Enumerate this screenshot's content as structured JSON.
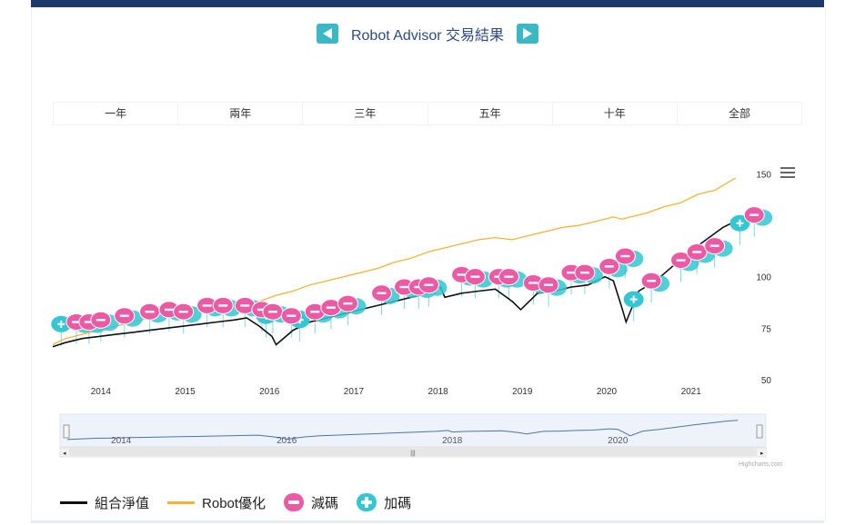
{
  "header": {
    "title": "Robot Advisor 交易結果",
    "prev_icon": "arrow-left-icon",
    "next_icon": "arrow-right-icon",
    "accent": "#3ab8c6",
    "title_color": "#2b4a86"
  },
  "tabs": [
    {
      "label": "一年"
    },
    {
      "label": "兩年"
    },
    {
      "label": "三年"
    },
    {
      "label": "五年"
    },
    {
      "label": "十年"
    },
    {
      "label": "全部"
    }
  ],
  "menu_icon": "hamburger-icon",
  "legend": {
    "portfolio": "組合淨值",
    "robot": "Robot優化",
    "reduce": "減碼",
    "add": "加碼"
  },
  "credits": "Highcharts.com",
  "chart_data": {
    "type": "line",
    "ylim": [
      50,
      155
    ],
    "y_ticks": [
      50,
      75,
      100,
      150
    ],
    "y_tick_labels": [
      "50",
      "75",
      "100",
      "150"
    ],
    "x_ticks": [
      "2014",
      "2015",
      "2016",
      "2017",
      "2018",
      "2019",
      "2020",
      "2021"
    ],
    "navigator_ticks": [
      "2014",
      "2016",
      "2018",
      "2020"
    ],
    "colors": {
      "portfolio": "#111111",
      "robot": "#f5b335",
      "reduce": "#ec5aa5",
      "add": "#34c6d3",
      "navigator": "#4a74b4"
    },
    "series": [
      {
        "name": "組合淨值",
        "x": [
          2013.45,
          2013.6,
          2013.8,
          2014.0,
          2014.2,
          2014.4,
          2014.6,
          2014.8,
          2015.0,
          2015.2,
          2015.4,
          2015.6,
          2015.75,
          2015.9,
          2016.05,
          2016.1,
          2016.3,
          2016.5,
          2016.7,
          2016.9,
          2017.1,
          2017.3,
          2017.5,
          2017.7,
          2017.9,
          2018.05,
          2018.1,
          2018.3,
          2018.5,
          2018.7,
          2018.9,
          2019.0,
          2019.2,
          2019.4,
          2019.6,
          2019.8,
          2020.0,
          2020.1,
          2020.2,
          2020.25,
          2020.4,
          2020.6,
          2020.8,
          2021.0,
          2021.2,
          2021.4,
          2021.55
        ],
        "values": [
          66,
          68,
          70,
          71,
          72,
          73,
          74,
          75,
          76,
          77,
          78,
          79,
          80,
          76,
          71,
          67,
          74,
          78,
          80,
          82,
          84,
          86,
          88,
          90,
          92,
          95,
          90,
          92,
          93,
          94,
          88,
          84,
          92,
          93,
          95,
          96,
          100,
          98,
          85,
          78,
          93,
          98,
          105,
          112,
          118,
          124,
          127
        ]
      },
      {
        "name": "Robot優化",
        "x": [
          2013.45,
          2013.6,
          2013.8,
          2014.0,
          2014.2,
          2014.4,
          2014.6,
          2014.8,
          2015.0,
          2015.2,
          2015.4,
          2015.6,
          2015.75,
          2015.9,
          2016.1,
          2016.3,
          2016.5,
          2016.7,
          2016.9,
          2017.1,
          2017.3,
          2017.5,
          2017.7,
          2017.9,
          2018.1,
          2018.3,
          2018.5,
          2018.7,
          2018.9,
          2019.1,
          2019.3,
          2019.5,
          2019.7,
          2019.9,
          2020.1,
          2020.2,
          2020.3,
          2020.5,
          2020.7,
          2020.9,
          2021.1,
          2021.3,
          2021.55
        ],
        "values": [
          67,
          70,
          72,
          74,
          76,
          78,
          80,
          82,
          84,
          85,
          86,
          86,
          87,
          88,
          91,
          93,
          96,
          98,
          100,
          102,
          104,
          107,
          109,
          112,
          114,
          116,
          118,
          119,
          118,
          120,
          122,
          124,
          125,
          127,
          129,
          128,
          129,
          131,
          134,
          136,
          140,
          142,
          148
        ]
      }
    ],
    "flags_reduce": [
      {
        "x": 2013.73,
        "y": 78
      },
      {
        "x": 2013.88,
        "y": 78
      },
      {
        "x": 2014.02,
        "y": 79
      },
      {
        "x": 2014.3,
        "y": 81
      },
      {
        "x": 2014.6,
        "y": 83
      },
      {
        "x": 2014.83,
        "y": 84
      },
      {
        "x": 2015.0,
        "y": 83
      },
      {
        "x": 2015.28,
        "y": 86
      },
      {
        "x": 2015.47,
        "y": 86
      },
      {
        "x": 2015.73,
        "y": 86
      },
      {
        "x": 2015.93,
        "y": 84
      },
      {
        "x": 2016.06,
        "y": 83
      },
      {
        "x": 2016.28,
        "y": 81
      },
      {
        "x": 2016.56,
        "y": 83
      },
      {
        "x": 2016.75,
        "y": 85
      },
      {
        "x": 2016.95,
        "y": 87
      },
      {
        "x": 2017.35,
        "y": 92
      },
      {
        "x": 2017.62,
        "y": 95
      },
      {
        "x": 2017.79,
        "y": 95
      },
      {
        "x": 2017.91,
        "y": 96
      },
      {
        "x": 2018.3,
        "y": 101
      },
      {
        "x": 2018.46,
        "y": 100
      },
      {
        "x": 2018.74,
        "y": 100
      },
      {
        "x": 2018.86,
        "y": 100
      },
      {
        "x": 2019.15,
        "y": 97
      },
      {
        "x": 2019.33,
        "y": 96
      },
      {
        "x": 2019.6,
        "y": 102
      },
      {
        "x": 2019.76,
        "y": 102
      },
      {
        "x": 2020.05,
        "y": 105
      },
      {
        "x": 2020.24,
        "y": 110
      },
      {
        "x": 2020.55,
        "y": 98
      },
      {
        "x": 2020.9,
        "y": 108
      },
      {
        "x": 2021.09,
        "y": 112
      },
      {
        "x": 2021.3,
        "y": 115
      },
      {
        "x": 2021.77,
        "y": 130
      }
    ],
    "flags_add": [
      {
        "x": 2013.55,
        "y": 77
      },
      {
        "x": 2015.98,
        "y": 81
      },
      {
        "x": 2016.38,
        "y": 79
      },
      {
        "x": 2020.34,
        "y": 89
      },
      {
        "x": 2021.6,
        "y": 126
      }
    ]
  }
}
